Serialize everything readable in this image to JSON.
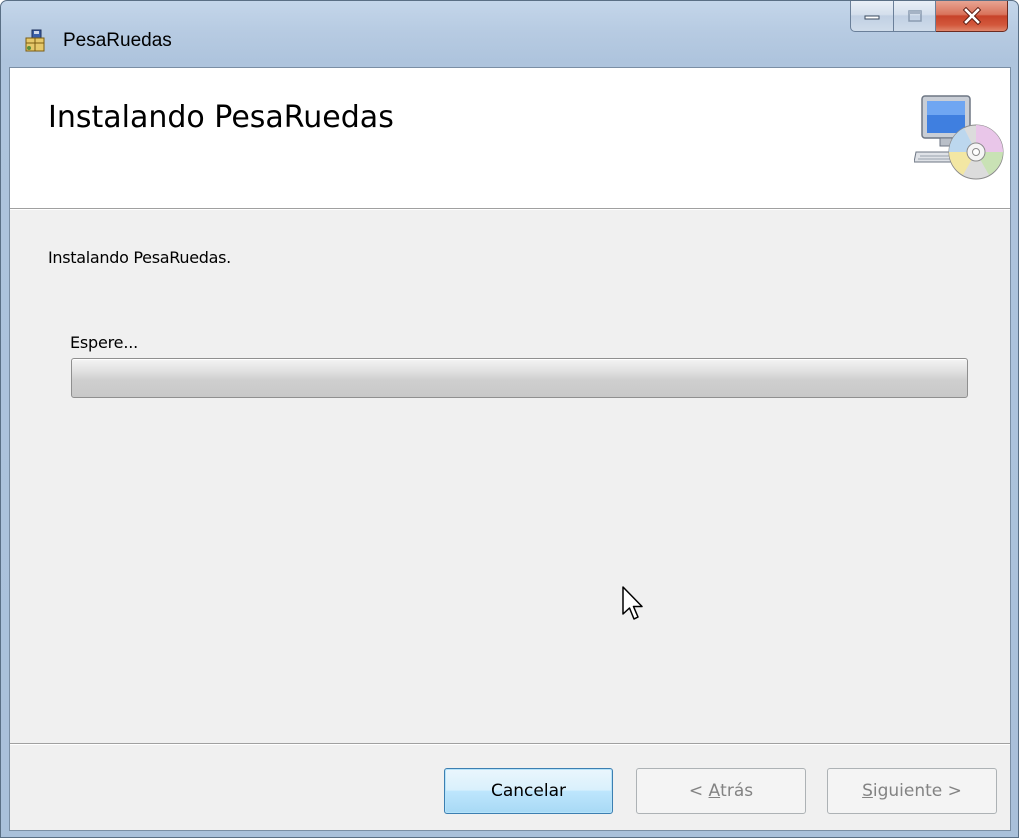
{
  "window": {
    "title": "PesaRuedas"
  },
  "header": {
    "title": "Instalando PesaRuedas"
  },
  "body": {
    "status_text": "Instalando PesaRuedas.",
    "progress_label": "Espere...",
    "progress_value": 0
  },
  "buttons": {
    "cancel_label": "Cancelar",
    "back_prefix": "< ",
    "back_accel": "A",
    "back_rest": "trás",
    "next_accel": "S",
    "next_rest": "iguiente >"
  },
  "icons": {
    "app": "installer-icon",
    "header": "computer-cd-icon",
    "minimize": "minimize-icon",
    "maximize": "maximize-icon",
    "close": "close-icon",
    "cursor": "mouse-pointer-icon"
  },
  "colors": {
    "close_button": "#c7432a",
    "frame": "#b7cbe2",
    "focused_button": "#3c7fb1"
  }
}
